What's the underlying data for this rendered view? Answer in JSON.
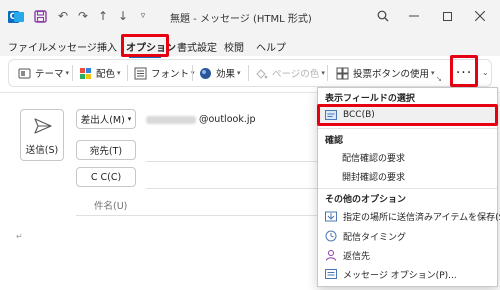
{
  "window": {
    "title": "無題 - メッセージ (HTML 形式)",
    "accent": "#0f6cbd",
    "highlight": "#e60012"
  },
  "menu": {
    "tabs": [
      "ファイル",
      "メッセージ",
      "挿入",
      "オプション",
      "書式設定",
      "校閲",
      "ヘルプ"
    ],
    "active": "オプション"
  },
  "ribbon": {
    "theme": "テーマ",
    "colors": "配色",
    "fonts": "フォント",
    "effects": "効果",
    "page_color": "ページの色",
    "voting": "投票ボタンの使用",
    "more": "···"
  },
  "compose": {
    "send": "送信(S)",
    "from_button": "差出人(M)",
    "from_email_visible": "@outlook.jp",
    "to_button": "宛先(T)",
    "cc_button": "C C(C)",
    "subject_label": "件名(U)",
    "body_mark": "↵"
  },
  "dropdown": {
    "section_fields": "表示フィールドの選択",
    "bcc": "BCC(B)",
    "section_confirm": "確認",
    "delivery_receipt": "配信確認の要求",
    "read_receipt": "開封確認の要求",
    "section_other": "その他のオプション",
    "save_sent": "指定の場所に送信済みアイテムを保存(S)",
    "delay_delivery": "配信タイミング",
    "reply_to": "返信先",
    "message_options": "メッセージ オプション(P)..."
  }
}
